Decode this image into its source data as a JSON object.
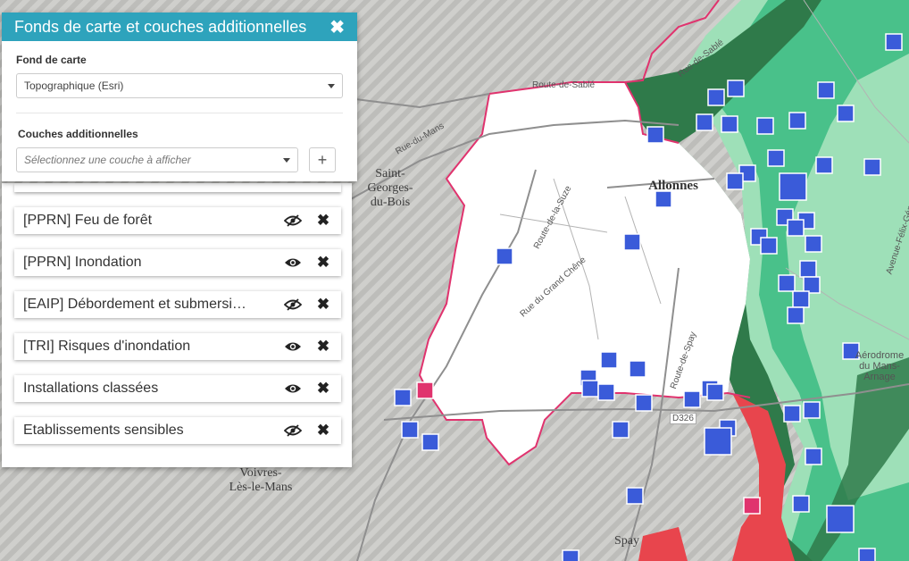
{
  "panel": {
    "title": "Fonds de carte et couches additionnelles",
    "basemap_label": "Fond de carte",
    "basemap_value": "Topographique (Esri)",
    "layers_label": "Couches additionnelles",
    "layers_placeholder": "Sélectionnez une couche à afficher",
    "add_button": "+"
  },
  "layers": [
    {
      "name": "[PPRN] Feu de forêt",
      "visibility_icon": "eye-slash-icon"
    },
    {
      "name": "[PPRN] Inondation",
      "visibility_icon": "eye-icon"
    },
    {
      "name": "[EAIP] Débordement et submersi…",
      "visibility_icon": "eye-slash-icon"
    },
    {
      "name": "[TRI] Risques d'inondation",
      "visibility_icon": "eye-icon"
    },
    {
      "name": "Installations classées",
      "visibility_icon": "eye-icon"
    },
    {
      "name": "Etablissements sensibles",
      "visibility_icon": "eye-slash-icon"
    }
  ],
  "map": {
    "places": {
      "saint_georges": "Saint-Georges-du-Bois",
      "saint_georges_l1": "Saint-",
      "saint_georges_l2": "Georges-",
      "saint_georges_l3": "du-Bois",
      "allonnes": "Allonnes",
      "voivres_l1": "Voivres-",
      "voivres_l2": "Lès-le-Mans",
      "spay": "Spay",
      "aerodrome_l1": "Aérodrome",
      "aerodrome_l2": "du Mans-",
      "aerodrome_l3": "Arnage"
    },
    "roads": {
      "sable_1": "Route-de-Sablé",
      "sable_2": "Rue-de-Sablé",
      "du_mans": "Rue-du-Mans",
      "suze": "Route-de-la-Suze",
      "grand_chene": "Rue du Grand Chêne",
      "spay_route": "Route-de-Spay",
      "d326": "D326",
      "chemin": "Avenue-Félix-Géneslay"
    },
    "colors": {
      "hatch": "#c7c7c4",
      "commune_fill": "#ffffff",
      "commune_border": "#e0336e",
      "flood_dark": "#2f7a4a",
      "flood_mid": "#49c18a",
      "flood_light": "#9ee0b8",
      "risk_red": "#e8454d",
      "icpe_blue": "#3a5bd9"
    }
  }
}
